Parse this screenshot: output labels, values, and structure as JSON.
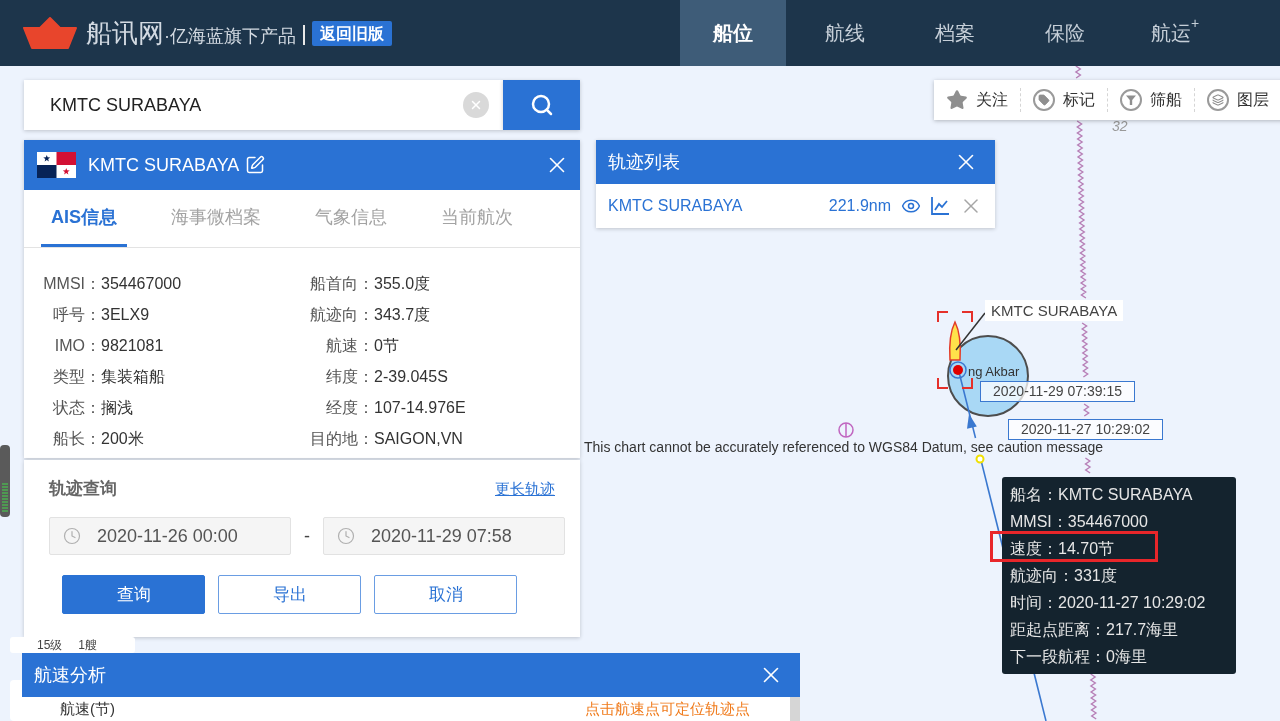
{
  "header": {
    "site_name": "船讯网",
    "tagline": "·亿海蓝旗下产品",
    "old_version_button": "返回旧版",
    "nav": [
      {
        "label": "船位",
        "selected": true
      },
      {
        "label": "航线",
        "selected": false
      },
      {
        "label": "档案",
        "selected": false
      },
      {
        "label": "保险",
        "selected": false
      },
      {
        "label": "航运",
        "superscript": "+",
        "selected": false
      }
    ]
  },
  "search": {
    "value": "KMTC SURABAYA"
  },
  "ship_panel": {
    "title": "KMTC SURABAYA",
    "tabs": [
      {
        "label": "AIS信息",
        "selected": true
      },
      {
        "label": "海事微档案",
        "selected": false
      },
      {
        "label": "气象信息",
        "selected": false
      },
      {
        "label": "当前航次",
        "selected": false
      }
    ],
    "rows": [
      [
        {
          "label": "MMSI：",
          "value": "354467000"
        },
        {
          "label": "船首向：",
          "value": "355.0度"
        }
      ],
      [
        {
          "label": "呼号：",
          "value": "3ELX9"
        },
        {
          "label": "航迹向：",
          "value": "343.7度"
        }
      ],
      [
        {
          "label": "IMO：",
          "value": "9821081"
        },
        {
          "label": "航速：",
          "value": "0节"
        }
      ],
      [
        {
          "label": "类型：",
          "value": "集装箱船"
        },
        {
          "label": "纬度：",
          "value": "2-39.045S"
        }
      ],
      [
        {
          "label": "状态：",
          "value": "搁浅"
        },
        {
          "label": "经度：",
          "value": "107-14.976E"
        }
      ],
      [
        {
          "label": "船长：",
          "value": "200米"
        },
        {
          "label": "目的地：",
          "value": "SAIGON,VN"
        }
      ]
    ]
  },
  "track_query": {
    "title": "轨迹查询",
    "link": "更长轨迹",
    "start_time": "2020-11-26 00:00",
    "separator": "-",
    "end_time": "2020-11-29 07:58",
    "buttons": [
      {
        "label": "查询",
        "kind": "primary"
      },
      {
        "label": "导出",
        "kind": "outline"
      },
      {
        "label": "取消",
        "kind": "outline"
      }
    ]
  },
  "zoom_badge": {
    "zoom": "15级",
    "ships": "1艘"
  },
  "speed_panel": {
    "title": "航速分析",
    "axis_label": "航速(节)",
    "hint": "点击航速点可定位轨迹点"
  },
  "track_list": {
    "title": "轨迹列表",
    "rows": [
      {
        "name": "KMTC SURABAYA",
        "distance": "221.9nm"
      }
    ]
  },
  "map_toolbar": [
    {
      "label": "关注"
    },
    {
      "label": "标记"
    },
    {
      "label": "筛船"
    },
    {
      "label": "图层"
    }
  ],
  "map": {
    "grid_label": "32",
    "ship_label": "KMTC SURABAYA",
    "place_label": "ng Akbar",
    "track_times": [
      "2020-11-29 07:39:15",
      "2020-11-27 10:29:02"
    ],
    "caution": "This chart cannot be accurately referenced to WGS84 Datum, see caution message"
  },
  "tooltip": {
    "lines": [
      {
        "text": "船名：KMTC SURABAYA",
        "highlighted": false
      },
      {
        "text": "MMSI：354467000",
        "highlighted": false
      },
      {
        "text": "速度：14.70节",
        "highlighted": true
      },
      {
        "text": "航迹向：331度",
        "highlighted": false
      },
      {
        "text": "时间：2020-11-27 10:29:02",
        "highlighted": false
      },
      {
        "text": "距起点距离：217.7海里",
        "highlighted": false
      },
      {
        "text": "下一段航程：0海里",
        "highlighted": false
      }
    ]
  }
}
